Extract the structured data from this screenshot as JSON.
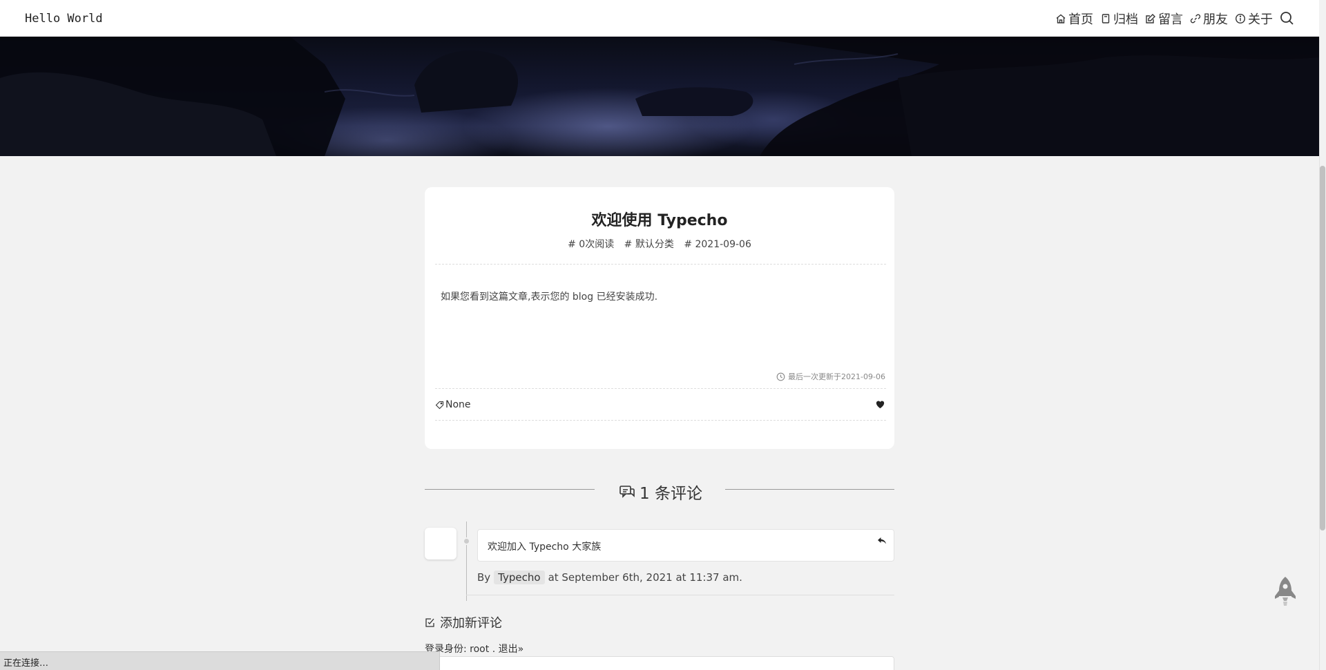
{
  "header": {
    "brand": "Hello World",
    "nav": [
      {
        "icon": "home-icon",
        "label": "首页"
      },
      {
        "icon": "archive-icon",
        "label": "归档"
      },
      {
        "icon": "edit-icon",
        "label": "留言"
      },
      {
        "icon": "link-icon",
        "label": "朋友"
      },
      {
        "icon": "info-icon",
        "label": "关于"
      }
    ],
    "search_icon": "search-icon"
  },
  "post": {
    "title": "欢迎使用 Typecho",
    "meta": {
      "views": "# 0次阅读",
      "category": "# 默认分类",
      "date": "# 2021-09-06"
    },
    "body": "如果您看到这篇文章,表示您的 blog 已经安装成功.",
    "updated": "最后一次更新于2021-09-06",
    "tag": "None"
  },
  "comments": {
    "heading": "1 条评论",
    "items": [
      {
        "text": "欢迎加入 Typecho 大家族",
        "by": "By",
        "author": "Typecho",
        "time": "at September 6th, 2021 at 11:37 am."
      }
    ]
  },
  "new_comment": {
    "heading": "添加新评论",
    "login_prefix": "登录身份: ",
    "user": "root",
    "dot": " . ",
    "logout": "退出»"
  },
  "status": {
    "text": "正在连接…"
  },
  "colors": {
    "background": "#f2f2f2",
    "card": "#ffffff",
    "text": "#333333"
  }
}
